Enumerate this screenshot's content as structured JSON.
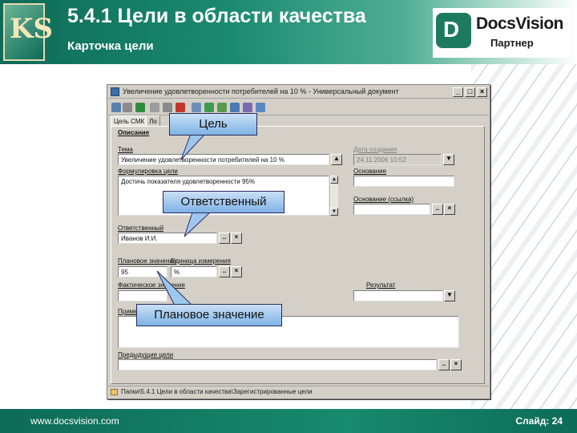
{
  "header": {
    "title": "5.4.1 Цели в области качества",
    "subtitle": "Карточка цели",
    "logo_left_letters": "KS",
    "logo_right": {
      "mark": "D",
      "name": "DocsVision",
      "sub": "Партнер"
    }
  },
  "window": {
    "title": "Увеличение удовлетворенности потребителей на 10 % - Универсальный документ",
    "buttons": {
      "minimize": "_",
      "maximize": "□",
      "close": "×"
    },
    "tabs": [
      "Цель СМК",
      "Ло"
    ],
    "section_title": "Описание",
    "fields": {
      "topic_label": "Тема",
      "topic_value": "Увеличение удовлетворенности потребителей на 10 %",
      "formulation_label": "Формулировка цели",
      "formulation_value": "Достичь показателя удовлетворенности 95%",
      "responsible_label": "Ответственный",
      "responsible_value": "Иванов И.И.",
      "planned_label": "Плановое значение",
      "unit_label": "Единица измерения",
      "planned_value": "95",
      "unit_value": "%",
      "actual_label": "Фактическое значение",
      "note_label": "Примечание",
      "previous_label": "Предыдущие цели",
      "creation_date_label": "Дата создания",
      "creation_date_value": "24.11.2006 10:52",
      "basis_label": "Основание",
      "basis_link_label": "Основание (ссылка)",
      "result_label": "Результат"
    },
    "status_text": "Папки\\5.4.1 Цели в области качества\\Зарегистрированные цели"
  },
  "callouts": {
    "goal": "Цель",
    "responsible": "Ответственный",
    "planned": "Плановое значение"
  },
  "footer": {
    "url": "www.docsvision.com",
    "slide": "Слайд: 24"
  },
  "colors": {
    "header_green": "#0d6b57",
    "callout_blue": "#7fb3e6",
    "window_gray": "#d4d0c8"
  }
}
